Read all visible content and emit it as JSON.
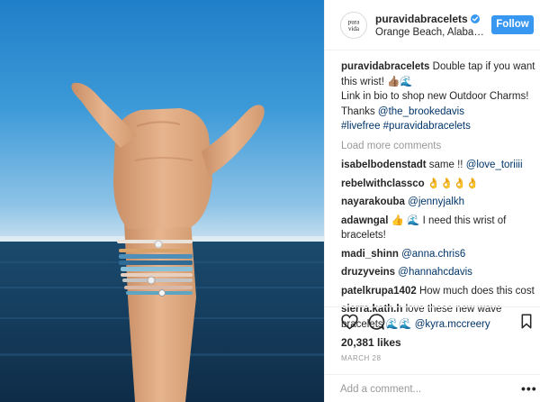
{
  "post": {
    "username": "puravidabracelets",
    "location": "Orange Beach, Alabama",
    "follow_label": "Follow",
    "avatar_text_top": "pura",
    "avatar_text_bottom": "vida"
  },
  "caption": {
    "username": "puravidabracelets",
    "line1": " Double tap if you want this wrist! 👍🏽🌊",
    "line2": "Link in bio to shop new Outdoor Charms!",
    "line3_prefix": "Thanks ",
    "mention": "@the_brookedavis",
    "hashtags": "#livefree #puravidabracelets"
  },
  "load_more": "Load more comments",
  "comments": [
    {
      "user": "isabelbodenstadt",
      "text": " same !! ",
      "mention": "@love_toriiii"
    },
    {
      "user": "rebelwithclassco",
      "text": " 👌👌👌👌",
      "mention": ""
    },
    {
      "user": "nayarakouba",
      "text": " ",
      "mention": "@jennyjalkh"
    },
    {
      "user": "adawngal",
      "text": " 👍 🌊 I need this wrist of bracelets!",
      "mention": ""
    },
    {
      "user": "madi_shinn",
      "text": " ",
      "mention": "@anna.chris6"
    },
    {
      "user": "druzyveins",
      "text": " ",
      "mention": "@hannahcdavis"
    },
    {
      "user": "patelkrupa1402",
      "text": " How much does this cost",
      "mention": ""
    },
    {
      "user": "sierra.kath.h",
      "text": " love these new wave bracelets 🌊🌊 ",
      "mention": "@kyra.mccreery"
    }
  ],
  "stats": {
    "likes": "20,381 likes",
    "date": "MARCH 28"
  },
  "add_comment": {
    "placeholder": "Add a comment..."
  },
  "icons": {
    "like": "heart-icon",
    "comment": "comment-bubble-icon",
    "save": "bookmark-icon",
    "more": "more-dots-icon",
    "verified": "verified-badge-icon"
  },
  "colors": {
    "accent": "#3897f0",
    "link": "#003569",
    "muted": "#999999",
    "text": "#262626"
  }
}
